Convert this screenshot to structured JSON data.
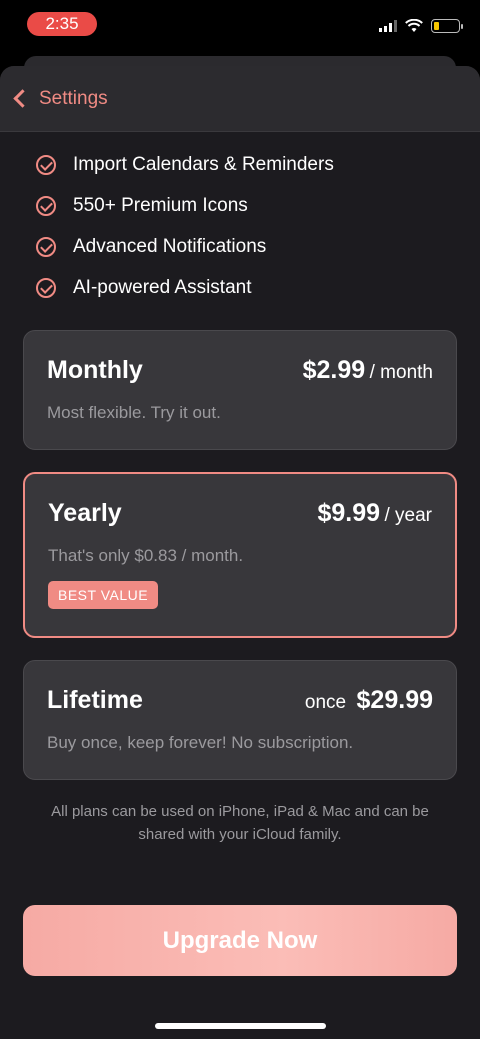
{
  "status": {
    "time": "2:35"
  },
  "nav": {
    "back_label": "Settings"
  },
  "features": [
    "Import Calendars & Reminders",
    "550+ Premium Icons",
    "Advanced Notifications",
    "AI-powered Assistant"
  ],
  "plans": {
    "monthly": {
      "name": "Monthly",
      "price": "$2.99",
      "unit": "/ month",
      "description": "Most flexible. Try it out."
    },
    "yearly": {
      "name": "Yearly",
      "price": "$9.99",
      "unit": "/ year",
      "description": "That's only $0.83 / month.",
      "badge": "BEST VALUE"
    },
    "lifetime": {
      "name": "Lifetime",
      "prefix": "once",
      "price": "$29.99",
      "description": "Buy once, keep forever! No subscription."
    }
  },
  "footnote": "All plans can be used on iPhone, iPad & Mac and can be shared with your iCloud family.",
  "cta": {
    "label": "Upgrade Now"
  },
  "colors": {
    "accent": "#f08b84",
    "background": "#1c1b1f",
    "card": "#38373b"
  }
}
